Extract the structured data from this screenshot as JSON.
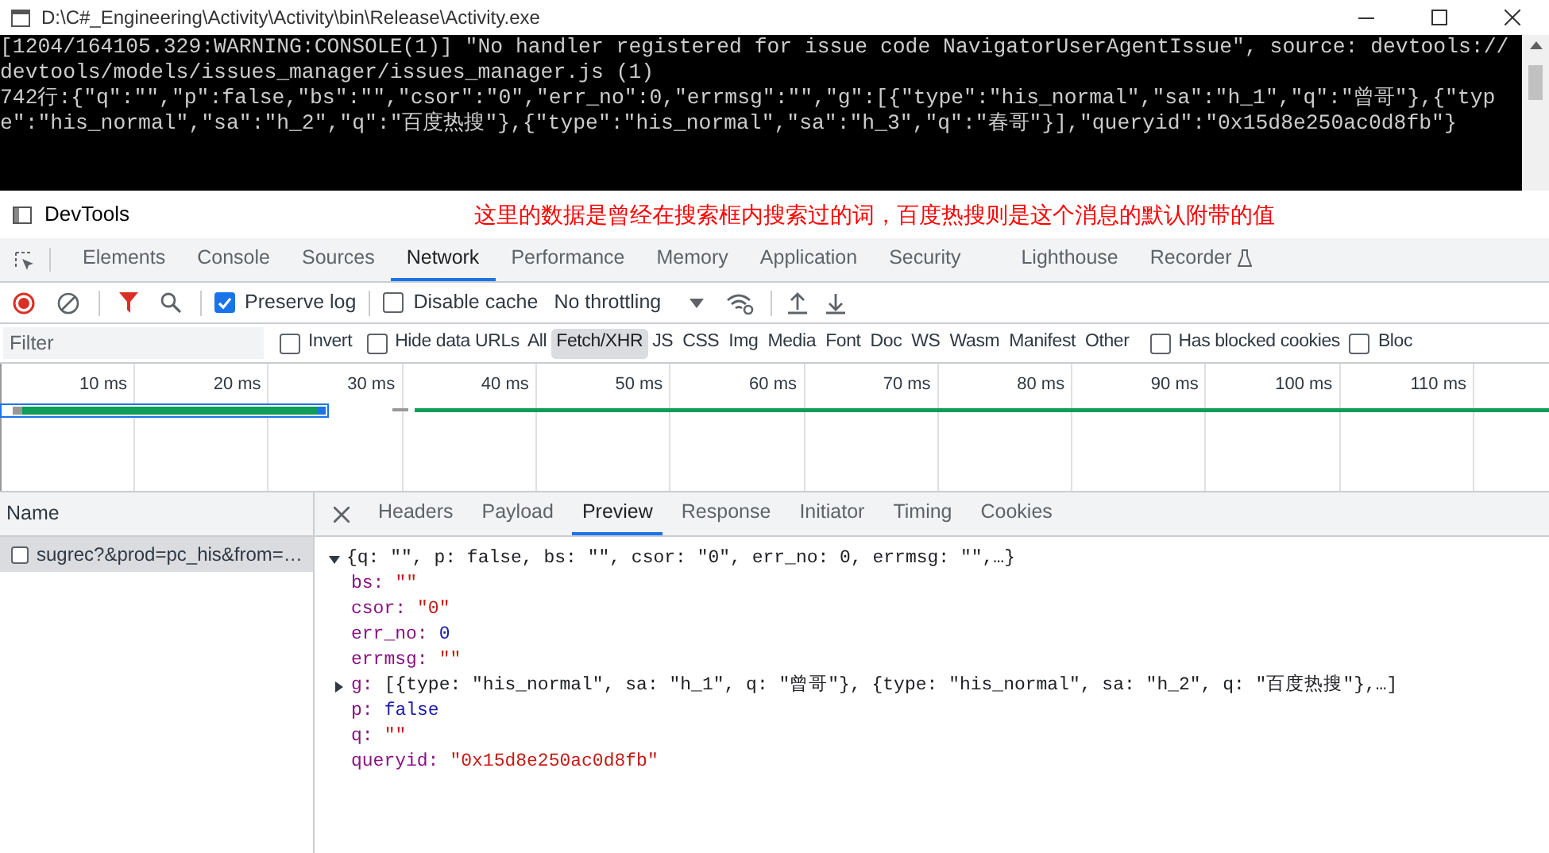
{
  "window": {
    "title": "D:\\C#_Engineering\\Activity\\Activity\\bin\\Release\\Activity.exe"
  },
  "console_lines": [
    "[1204/164105.329:WARNING:CONSOLE(1)] \"No handler registered for issue code NavigatorUserAgentIssue\", source: devtools://",
    "devtools/models/issues_manager/issues_manager.js (1)",
    "742行:{\"q\":\"\",\"p\":false,\"bs\":\"\",\"csor\":\"0\",\"err_no\":0,\"errmsg\":\"\",\"g\":[{\"type\":\"his_normal\",\"sa\":\"h_1\",\"q\":\"曾哥\"},{\"typ",
    "e\":\"his_normal\",\"sa\":\"h_2\",\"q\":\"百度热搜\"},{\"type\":\"his_normal\",\"sa\":\"h_3\",\"q\":\"春哥\"}],\"queryid\":\"0x15d8e250ac0d8fb\"}"
  ],
  "devtools": {
    "title": "DevTools",
    "annotation": "这里的数据是曾经在搜索框内搜索过的词，百度热搜则是这个消息的默认附带的值"
  },
  "tabs": [
    {
      "label": "Elements",
      "selected": false
    },
    {
      "label": "Console",
      "selected": false
    },
    {
      "label": "Sources",
      "selected": false
    },
    {
      "label": "Network",
      "selected": true
    },
    {
      "label": "Performance",
      "selected": false
    },
    {
      "label": "Memory",
      "selected": false
    },
    {
      "label": "Application",
      "selected": false
    },
    {
      "label": "Security",
      "selected": false
    },
    {
      "label": "Lighthouse",
      "selected": false
    },
    {
      "label": "Recorder",
      "selected": false
    }
  ],
  "toolbar": {
    "preserve_log": {
      "label": "Preserve log",
      "checked": true
    },
    "disable_cache": {
      "label": "Disable cache",
      "checked": false
    },
    "throttling": "No throttling"
  },
  "filter": {
    "placeholder": "Filter",
    "invert": {
      "label": "Invert",
      "checked": false
    },
    "hide_data_urls": {
      "label": "Hide data URLs",
      "checked": false
    },
    "types": [
      {
        "label": "All",
        "selected": false
      },
      {
        "label": "Fetch/XHR",
        "selected": true
      },
      {
        "label": "JS",
        "selected": false
      },
      {
        "label": "CSS",
        "selected": false
      },
      {
        "label": "Img",
        "selected": false
      },
      {
        "label": "Media",
        "selected": false
      },
      {
        "label": "Font",
        "selected": false
      },
      {
        "label": "Doc",
        "selected": false
      },
      {
        "label": "WS",
        "selected": false
      },
      {
        "label": "Wasm",
        "selected": false
      },
      {
        "label": "Manifest",
        "selected": false
      },
      {
        "label": "Other",
        "selected": false
      }
    ],
    "blocked_cookies": {
      "label": "Has blocked cookies",
      "checked": false
    },
    "blocked_requests": {
      "label": "Bloc",
      "checked": false
    }
  },
  "timeline": {
    "ticks": [
      "10 ms",
      "20 ms",
      "30 ms",
      "40 ms",
      "50 ms",
      "60 ms",
      "70 ms",
      "80 ms",
      "90 ms",
      "100 ms",
      "110 ms"
    ]
  },
  "requests": {
    "column": "Name",
    "rows": [
      {
        "name": "sugrec?&prod=pc_his&from=…",
        "selected": true,
        "checked": false
      }
    ]
  },
  "detail_tabs": [
    {
      "label": "Headers",
      "selected": false
    },
    {
      "label": "Payload",
      "selected": false
    },
    {
      "label": "Preview",
      "selected": true
    },
    {
      "label": "Response",
      "selected": false
    },
    {
      "label": "Initiator",
      "selected": false
    },
    {
      "label": "Timing",
      "selected": false
    },
    {
      "label": "Cookies",
      "selected": false
    }
  ],
  "preview": {
    "summary": "{q: \"\", p: false, bs: \"\", csor: \"0\", err_no: 0, errmsg: \"\",…}",
    "expanded": true,
    "children": [
      {
        "key": "bs:",
        "value": "\"\"",
        "kind": "string"
      },
      {
        "key": "csor:",
        "value": "\"0\"",
        "kind": "string"
      },
      {
        "key": "err_no:",
        "value": "0",
        "kind": "number"
      },
      {
        "key": "errmsg:",
        "value": "\"\"",
        "kind": "string"
      },
      {
        "key": "g:",
        "value": "[{type: \"his_normal\", sa: \"h_1\", q: \"曾哥\"}, {type: \"his_normal\", sa: \"h_2\", q: \"百度热搜\"},…]",
        "kind": "object",
        "expanded": false
      },
      {
        "key": "p:",
        "value": "false",
        "kind": "number"
      },
      {
        "key": "q:",
        "value": "\"\"",
        "kind": "string"
      },
      {
        "key": "queryid:",
        "value": "\"0x15d8e250ac0d8fb\"",
        "kind": "string"
      }
    ]
  }
}
